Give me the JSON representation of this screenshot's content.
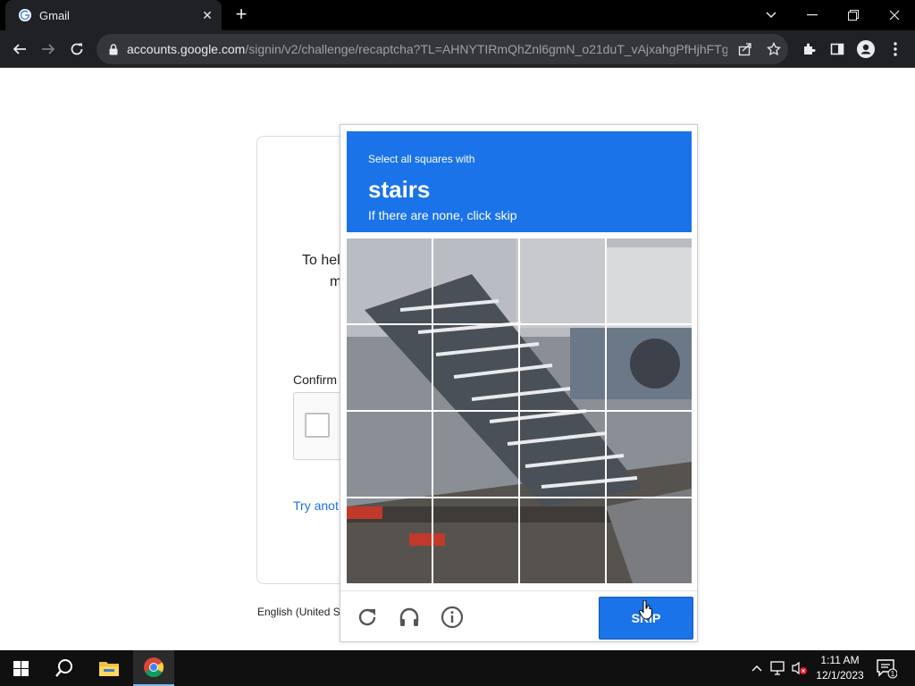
{
  "browser": {
    "tab_title": "Gmail",
    "tab_close": "✕",
    "newtab": "+",
    "url_host": "accounts.google.com",
    "url_path": "/signin/v2/challenge/recaptcha?TL=AHNYTIRmQhZnl6gmN_o21duT_vAjxahgPfHjhFTg..."
  },
  "signin_page": {
    "text_line1": "To hel",
    "text_line2": "m",
    "confirm_label": "Confirm",
    "try_another": "Try anot",
    "language": "English (United S"
  },
  "challenge": {
    "instruction_line1": "Select all squares with",
    "keyword": "stairs",
    "instruction_line3": "If there are none, click skip",
    "skip_label": "SKIP",
    "tiles": [
      1,
      2,
      3,
      4,
      5,
      6,
      7,
      8,
      9,
      10,
      11,
      12,
      13,
      14,
      15,
      16
    ],
    "icons": [
      "reload-icon",
      "headphones-icon",
      "info-icon"
    ]
  },
  "taskbar": {
    "time": "1:11 AM",
    "date": "12/1/2023",
    "notification_count": "1"
  },
  "colors": {
    "accent": "#1a73e8",
    "chrome_dark": "#202124",
    "taskbar": "#101010"
  }
}
